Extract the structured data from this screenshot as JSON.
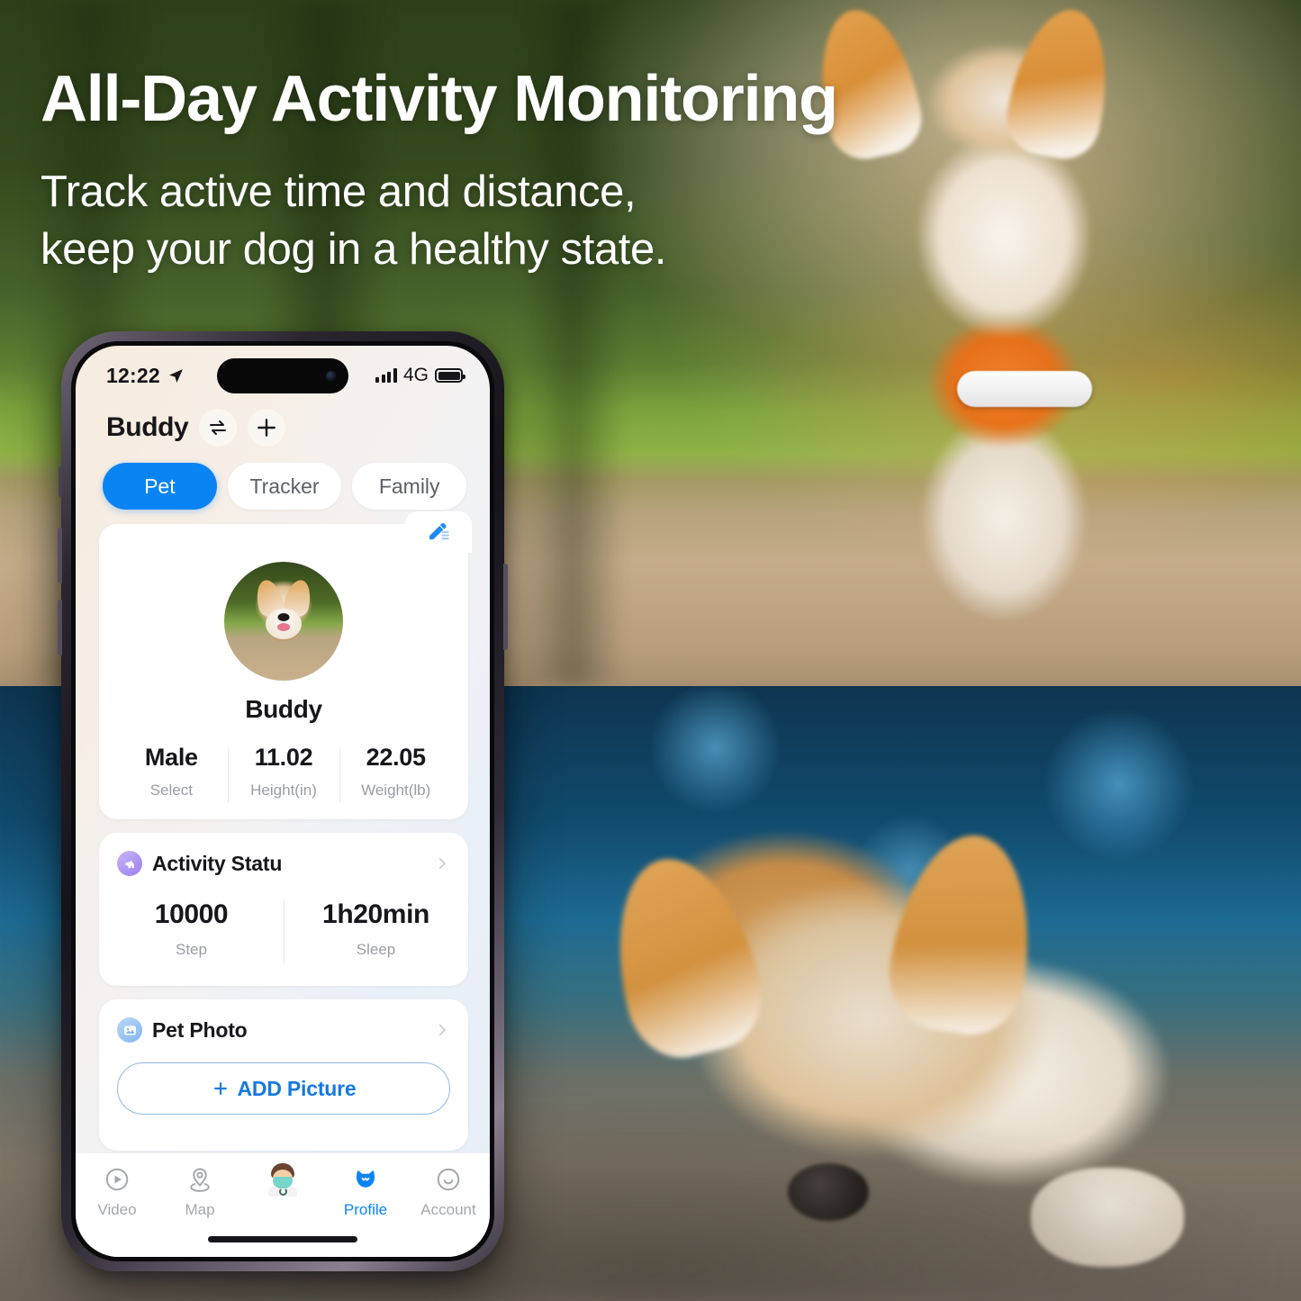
{
  "marketing": {
    "headline": "All-Day Activity Monitoring",
    "subcopy_line1": "Track active time and distance,",
    "subcopy_line2": "keep your dog in a healthy state."
  },
  "phone": {
    "statusbar": {
      "time": "12:22",
      "location_icon": "location-arrow-icon",
      "signal_icon": "signal-bars-icon",
      "network": "4G",
      "battery_icon": "battery-full-icon"
    },
    "header": {
      "pet_name": "Buddy",
      "switch_icon": "swap-arrows-icon",
      "add_icon": "plus-icon"
    },
    "tabs": [
      {
        "label": "Pet",
        "active": true
      },
      {
        "label": "Tracker",
        "active": false
      },
      {
        "label": "Family",
        "active": false
      }
    ],
    "profile_card": {
      "edit_icon": "edit-pen-icon",
      "avatar_icon": "pet-avatar-photo",
      "name": "Buddy",
      "stats": [
        {
          "value": "Male",
          "label": "Select"
        },
        {
          "value": "11.02",
          "label": "Height(in)"
        },
        {
          "value": "22.05",
          "label": "Weight(lb)"
        }
      ]
    },
    "activity_card": {
      "icon": "activity-dog-icon",
      "title": "Activity Statu",
      "chevron_icon": "chevron-right-icon",
      "stats": [
        {
          "value": "10000",
          "label": "Step"
        },
        {
          "value": "1h20min",
          "label": "Sleep"
        }
      ]
    },
    "photo_card": {
      "icon": "photo-image-icon",
      "title": "Pet Photo",
      "chevron_icon": "chevron-right-icon",
      "add_button": {
        "plus_icon": "plus-icon",
        "label": "ADD Picture"
      }
    },
    "tabbar": [
      {
        "label": "Video",
        "icon": "play-circle-icon",
        "active": false
      },
      {
        "label": "Map",
        "icon": "map-pin-icon",
        "active": false
      },
      {
        "label": "",
        "icon": "doctor-emoji-icon",
        "active": false
      },
      {
        "label": "Profile",
        "icon": "pet-head-icon",
        "active": true
      },
      {
        "label": "Account",
        "icon": "smiley-circle-icon",
        "active": false
      }
    ],
    "home_indicator": "home-bar"
  },
  "colors": {
    "accent_blue": "#0b84f3",
    "link_blue": "#1679e0",
    "text_dark": "#17171b",
    "text_muted": "#9a9da3",
    "activity_purple": "#9b7df0",
    "photo_blue": "#7fb4ee"
  }
}
